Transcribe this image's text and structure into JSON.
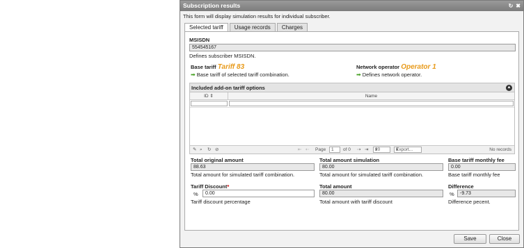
{
  "window": {
    "title": "Subscription results",
    "description": "This form will display simulation results for individual subscriber."
  },
  "tabs": [
    {
      "label": "Selected tariff"
    },
    {
      "label": "Usage records"
    },
    {
      "label": "Charges"
    }
  ],
  "msisdn": {
    "label": "MSISDN",
    "value": "554545167",
    "help": "Defines subscriber MSISDN."
  },
  "base_tariff": {
    "label": "Base tariff",
    "value": "Tariff 83",
    "help": "Base tariff of selected tariff combination."
  },
  "network_operator": {
    "label": "Network operator",
    "value": "Operator 1",
    "help": "Defines network operator."
  },
  "addons": {
    "title": "Included add-on tariff options",
    "columns": [
      "ID",
      "Name"
    ],
    "pager": {
      "page_label": "Page",
      "page_value": "1",
      "of_label": "of 0",
      "page_size": "20",
      "export_label": "Export...",
      "empty_text": "No records"
    }
  },
  "summary": {
    "total_original_amount": {
      "label": "Total original amount",
      "value": "88.63",
      "help": "Total amount for simulated tariff combination."
    },
    "total_amount_simulation": {
      "label": "Total amount simulation",
      "value": "80.00",
      "help": "Total amount for simulated tariff combination."
    },
    "base_tariff_monthly_fee": {
      "label": "Base tariff monthly fee",
      "value": "0.00",
      "help": "Base tariff monthly fee"
    },
    "tariff_discount": {
      "label": "Tariff Discount",
      "required_mark": "*",
      "unit": "%",
      "value": "0.00",
      "help": "Tariff discount percentage"
    },
    "total_amount": {
      "label": "Total amount",
      "value": "80.00",
      "help": "Total amount with tariff discount"
    },
    "difference": {
      "label": "Difference",
      "unit": "%",
      "value": "-9.73",
      "help": "Difference pecent."
    }
  },
  "buttons": {
    "save": "Save",
    "close": "Close"
  }
}
